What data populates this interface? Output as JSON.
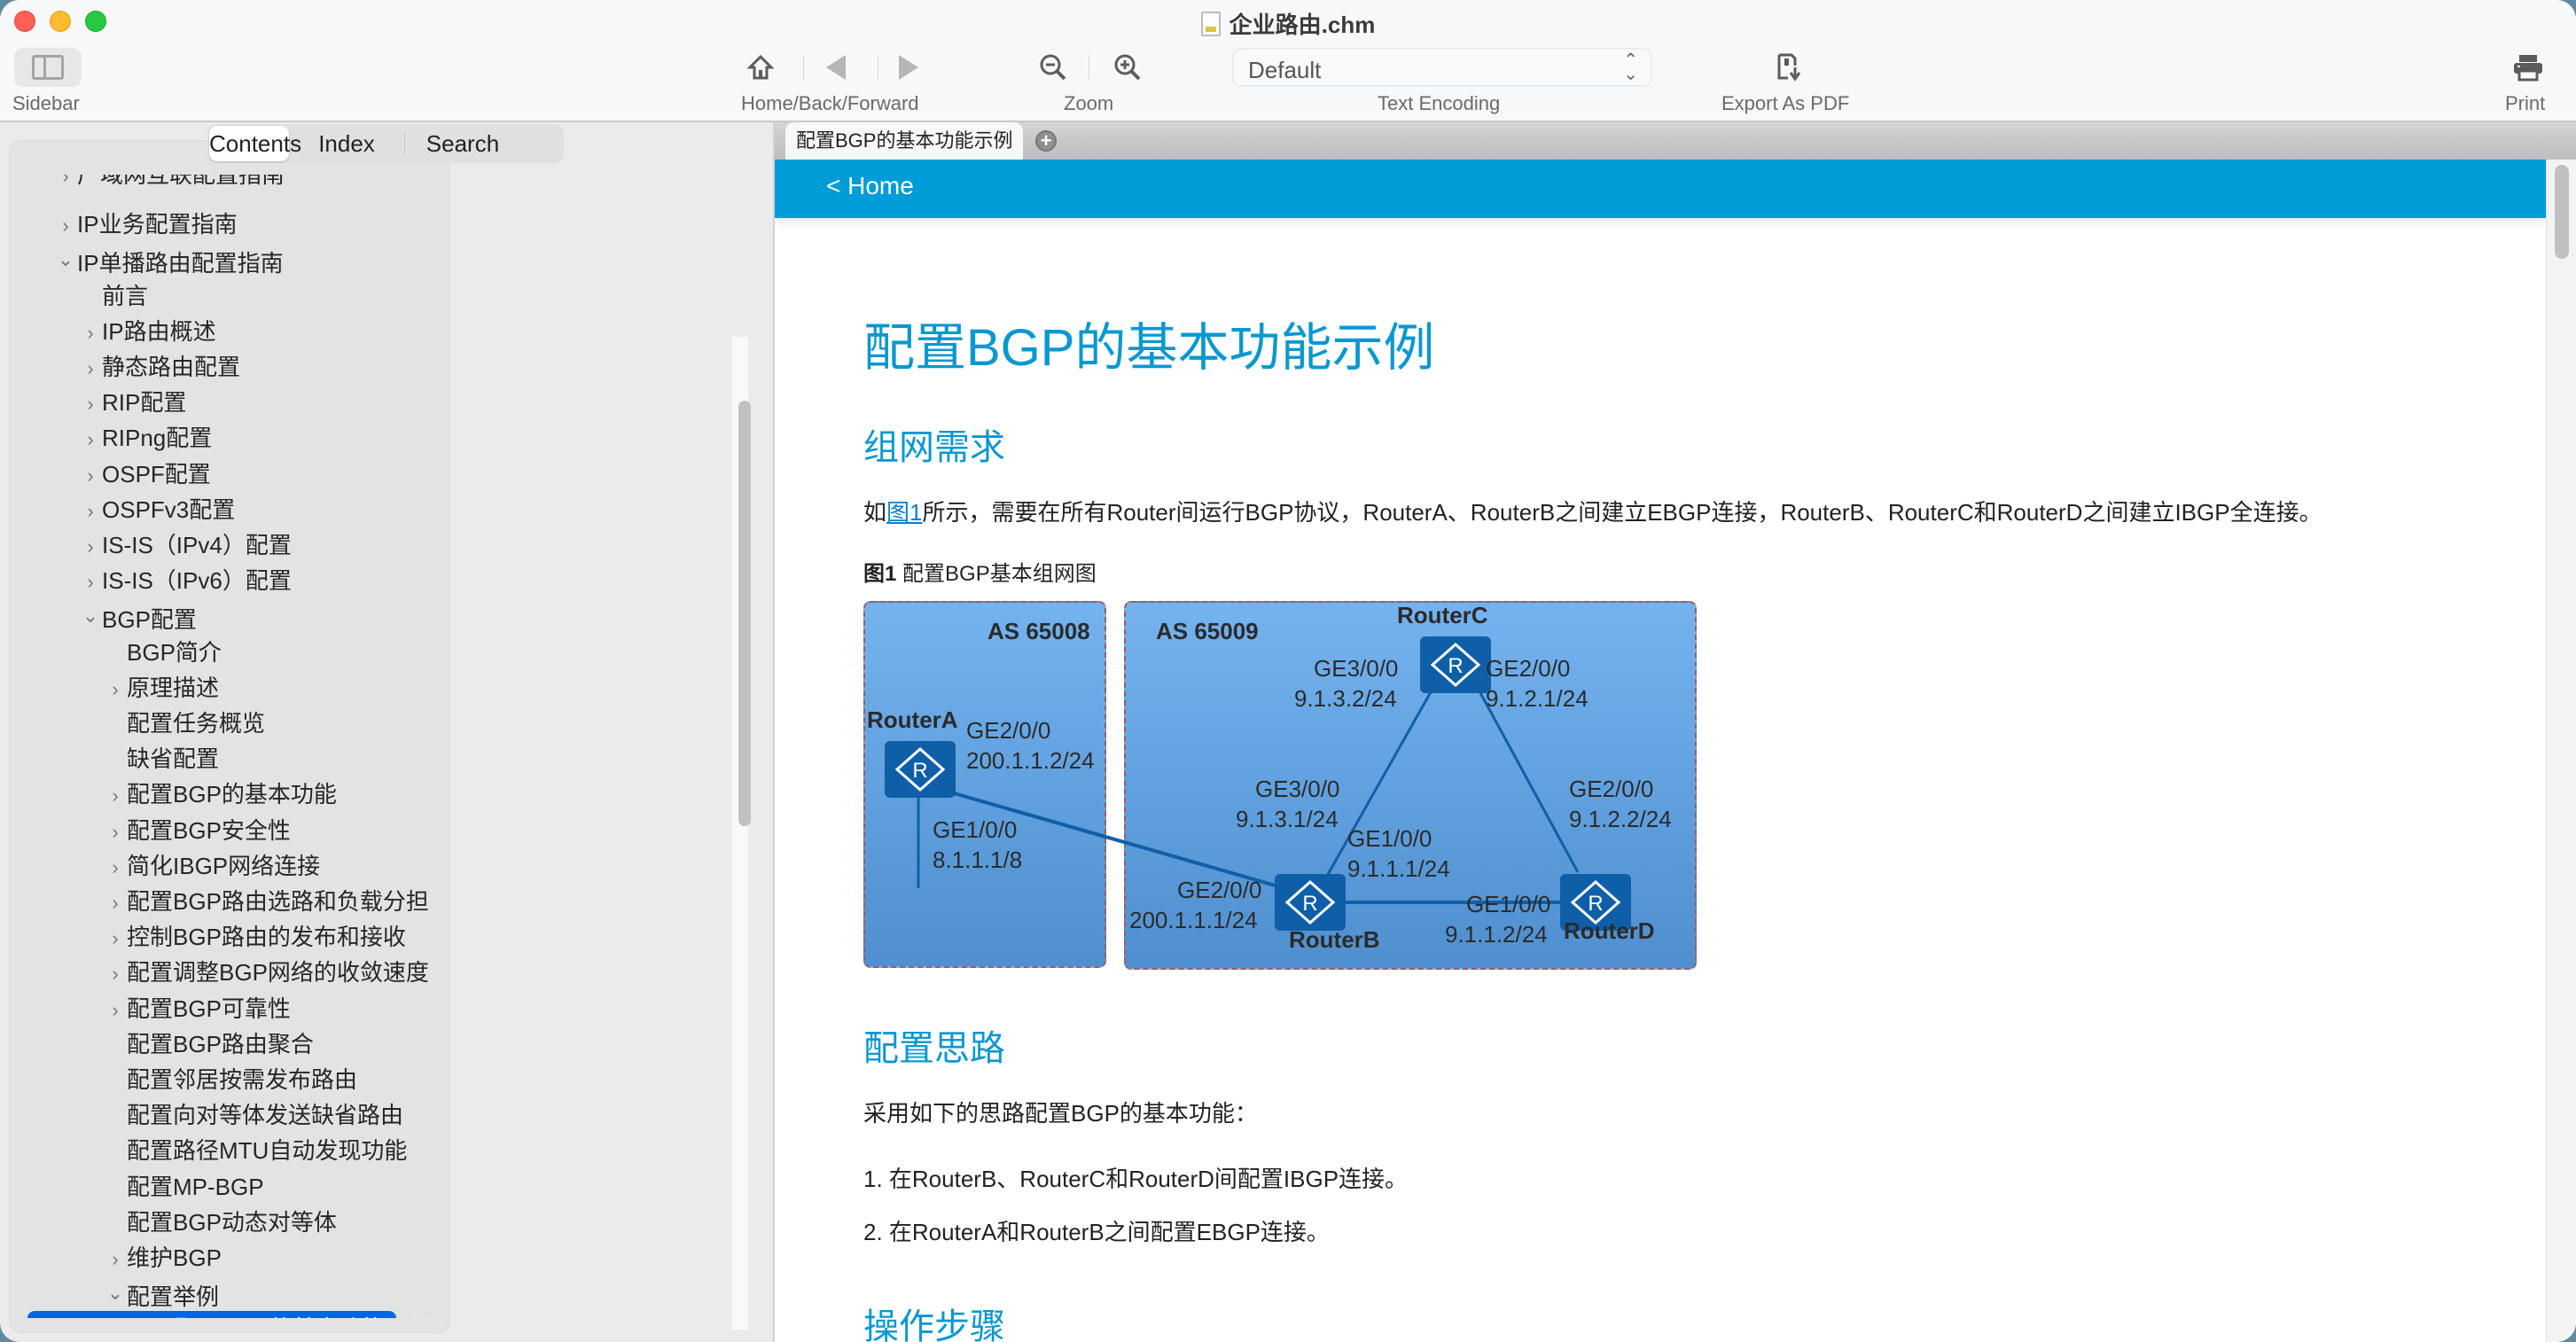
{
  "window": {
    "title": "企业路由.chm",
    "traffic_lights": [
      "close",
      "minimize",
      "zoom"
    ]
  },
  "toolbar": {
    "sidebar_label": "Sidebar",
    "nav_label": "Home/Back/Forward",
    "zoom_label": "Zoom",
    "encoding_value": "Default",
    "encoding_label": "Text Encoding",
    "export_label": "Export As PDF",
    "print_label": "Print"
  },
  "sidebar": {
    "tabs": [
      {
        "label": "Contents",
        "active": true
      },
      {
        "label": "Index",
        "active": false
      },
      {
        "label": "Search",
        "active": false
      }
    ],
    "toc": [
      {
        "label": "广域网互联配置指南",
        "level": 0,
        "chevron": "right",
        "clipped": true
      },
      {
        "label": "IP业务配置指南",
        "level": 0,
        "chevron": "right"
      },
      {
        "label": "IP单播路由配置指南",
        "level": 0,
        "chevron": "down"
      },
      {
        "label": "前言",
        "level": 1,
        "chevron": ""
      },
      {
        "label": "IP路由概述",
        "level": 1,
        "chevron": "right"
      },
      {
        "label": "静态路由配置",
        "level": 1,
        "chevron": "right"
      },
      {
        "label": "RIP配置",
        "level": 1,
        "chevron": "right"
      },
      {
        "label": "RIPng配置",
        "level": 1,
        "chevron": "right"
      },
      {
        "label": "OSPF配置",
        "level": 1,
        "chevron": "right"
      },
      {
        "label": "OSPFv3配置",
        "level": 1,
        "chevron": "right"
      },
      {
        "label": "IS-IS（IPv4）配置",
        "level": 1,
        "chevron": "right"
      },
      {
        "label": "IS-IS（IPv6）配置",
        "level": 1,
        "chevron": "right"
      },
      {
        "label": "BGP配置",
        "level": 1,
        "chevron": "down"
      },
      {
        "label": "BGP简介",
        "level": 2,
        "chevron": ""
      },
      {
        "label": "原理描述",
        "level": 2,
        "chevron": "right"
      },
      {
        "label": "配置任务概览",
        "level": 2,
        "chevron": ""
      },
      {
        "label": "缺省配置",
        "level": 2,
        "chevron": ""
      },
      {
        "label": "配置BGP的基本功能",
        "level": 2,
        "chevron": "right"
      },
      {
        "label": "配置BGP安全性",
        "level": 2,
        "chevron": "right"
      },
      {
        "label": "简化IBGP网络连接",
        "level": 2,
        "chevron": "right"
      },
      {
        "label": "配置BGP路由选路和负载分担",
        "level": 2,
        "chevron": "right"
      },
      {
        "label": "控制BGP路由的发布和接收",
        "level": 2,
        "chevron": "right"
      },
      {
        "label": "配置调整BGP网络的收敛速度",
        "level": 2,
        "chevron": "right"
      },
      {
        "label": "配置BGP可靠性",
        "level": 2,
        "chevron": "right"
      },
      {
        "label": "配置BGP路由聚合",
        "level": 2,
        "chevron": ""
      },
      {
        "label": "配置邻居按需发布路由",
        "level": 2,
        "chevron": ""
      },
      {
        "label": "配置向对等体发送缺省路由",
        "level": 2,
        "chevron": ""
      },
      {
        "label": "配置路径MTU自动发现功能",
        "level": 2,
        "chevron": ""
      },
      {
        "label": "配置MP-BGP",
        "level": 2,
        "chevron": ""
      },
      {
        "label": "配置BGP动态对等体",
        "level": 2,
        "chevron": ""
      },
      {
        "label": "维护BGP",
        "level": 2,
        "chevron": "right"
      },
      {
        "label": "配置举例",
        "level": 2,
        "chevron": "down"
      },
      {
        "label": "配置BGP的基本功能示例",
        "level": 3,
        "chevron": "",
        "selected": true
      }
    ]
  },
  "content": {
    "tab_label": "配置BGP的基本功能示例",
    "home_link": "< Home",
    "title": "配置BGP的基本功能示例",
    "section1": "组网需求",
    "para1_pre": "如",
    "para1_link": "图1",
    "para1_post": "所示，需要在所有Router间运行BGP协议，RouterA、RouterB之间建立EBGP连接，RouterB、RouterC和RouterD之间建立IBGP全连接。",
    "figure_num": "图1",
    "figure_caption": "配置BGP基本组网图",
    "section2": "配置思路",
    "para2": "采用如下的思路配置BGP的基本功能：",
    "steps": [
      "1.  在RouterB、RouterC和RouterD间配置IBGP连接。",
      "2.  在RouterA和RouterB之间配置EBGP连接。"
    ],
    "section3": "操作步骤"
  },
  "diagram": {
    "as_left": "AS 65008",
    "as_right": "AS 65009",
    "routers": {
      "a": {
        "name": "RouterA",
        "ports": [
          "GE2/0/0",
          "200.1.1.2/24",
          "GE1/0/0",
          "8.1.1.1/8"
        ]
      },
      "b": {
        "name": "RouterB",
        "ports": [
          "GE3/0/0",
          "9.1.3.1/24",
          "GE1/0/0",
          "9.1.1.1/24",
          "GE2/0/0",
          "200.1.1.1/24"
        ]
      },
      "c": {
        "name": "RouterC",
        "ports": [
          "GE3/0/0",
          "9.1.3.2/24",
          "GE2/0/0",
          "9.1.2.1/24"
        ]
      },
      "d": {
        "name": "RouterD",
        "ports": [
          "GE2/0/0",
          "9.1.2.2/24",
          "GE1/0/0",
          "9.1.1.2/24"
        ]
      }
    },
    "router_glyph": "R"
  }
}
